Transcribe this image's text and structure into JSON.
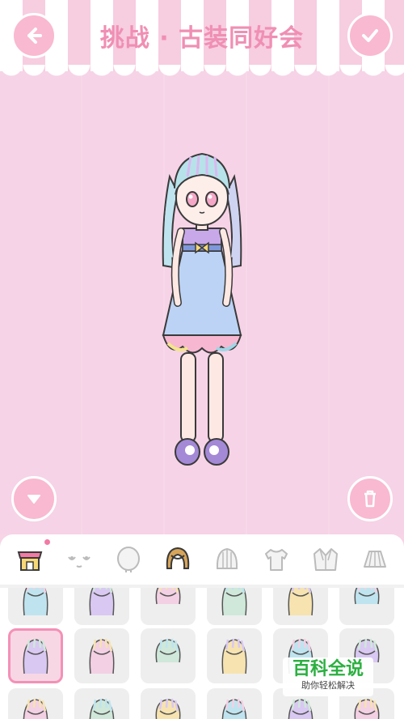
{
  "header": {
    "title": "挑战 · 古装同好会",
    "back_icon": "arrow-left-icon",
    "confirm_icon": "checkmark-icon"
  },
  "side_controls": {
    "collapse_icon": "triangle-down-icon",
    "trash_icon": "trash-icon"
  },
  "tabs": [
    {
      "id": "shop",
      "icon": "shop-icon",
      "has_notification": true
    },
    {
      "id": "face",
      "icon": "face-icon"
    },
    {
      "id": "head",
      "icon": "head-icon"
    },
    {
      "id": "hair",
      "icon": "hair-icon",
      "active": true
    },
    {
      "id": "hat",
      "icon": "hat-icon"
    },
    {
      "id": "top",
      "icon": "tshirt-icon"
    },
    {
      "id": "jacket",
      "icon": "jacket-icon"
    },
    {
      "id": "skirt",
      "icon": "skirt-icon"
    }
  ],
  "hair_grid": {
    "selected_index": 6,
    "items_visible": 18
  },
  "watermark": {
    "title": "百科全说",
    "subtitle": "助你轻松解决"
  },
  "colors": {
    "background_pink": "#f6d3e6",
    "accent_pink": "#f490b6",
    "watermark_green": "#2aaf3f"
  }
}
